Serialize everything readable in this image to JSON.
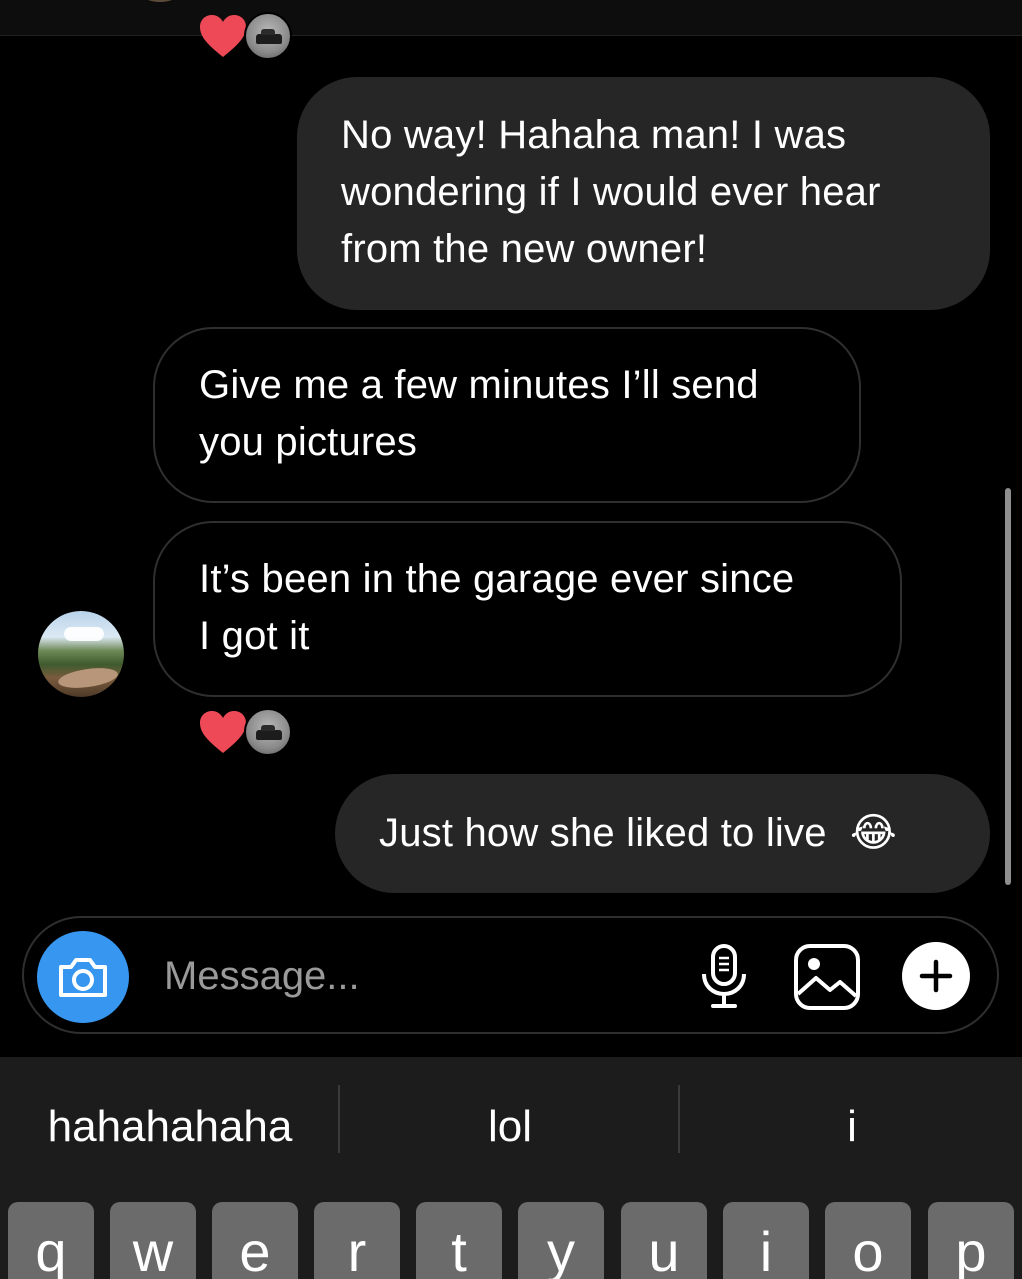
{
  "conversation": {
    "messages": [
      {
        "id": "m1",
        "direction": "sent",
        "text_lines": [
          "No way! Hahaha man! I was",
          "wondering if I would ever hear",
          "from the new owner!"
        ]
      },
      {
        "id": "m2",
        "direction": "received",
        "text_lines": [
          "Give me a few minutes I’ll send",
          "you pictures"
        ]
      },
      {
        "id": "m3",
        "direction": "received",
        "text_lines": [
          "It’s been in the garage ever since",
          "I got it"
        ]
      },
      {
        "id": "m4",
        "direction": "sent",
        "text": "Just how she liked to live",
        "emoji": "😂"
      }
    ],
    "reactions": [
      {
        "emoji": "heart-icon",
        "color": "#ed4956"
      },
      {
        "emoji": "heart-icon",
        "color": "#ed4956"
      }
    ]
  },
  "composer": {
    "placeholder": "Message...",
    "accent_color": "#3797f0"
  },
  "keyboard": {
    "suggestions": [
      "hahahahaha",
      "lol",
      "i"
    ],
    "top_row": [
      "q",
      "w",
      "e",
      "r",
      "t",
      "y",
      "u",
      "i",
      "o",
      "p"
    ]
  }
}
